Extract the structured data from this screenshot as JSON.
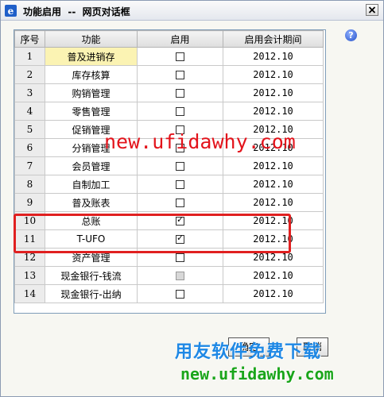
{
  "window": {
    "title": "功能启用  --  网页对话框",
    "close_glyph": "✕",
    "help_glyph": "?"
  },
  "table": {
    "headers": {
      "index": "序号",
      "function": "功能",
      "enable": "启用",
      "period": "启用会计期间"
    },
    "rows": [
      {
        "index": "1",
        "function": "普及进销存",
        "checked": false,
        "disabled": false,
        "period": "2012.10"
      },
      {
        "index": "2",
        "function": "库存核算",
        "checked": false,
        "disabled": false,
        "period": "2012.10"
      },
      {
        "index": "3",
        "function": "购销管理",
        "checked": false,
        "disabled": false,
        "period": "2012.10"
      },
      {
        "index": "4",
        "function": "零售管理",
        "checked": false,
        "disabled": false,
        "period": "2012.10"
      },
      {
        "index": "5",
        "function": "促销管理",
        "checked": false,
        "disabled": false,
        "period": "2012.10"
      },
      {
        "index": "6",
        "function": "分销管理",
        "checked": false,
        "disabled": false,
        "period": "2012.10"
      },
      {
        "index": "7",
        "function": "会员管理",
        "checked": false,
        "disabled": false,
        "period": "2012.10"
      },
      {
        "index": "8",
        "function": "自制加工",
        "checked": false,
        "disabled": false,
        "period": "2012.10"
      },
      {
        "index": "9",
        "function": "普及账表",
        "checked": false,
        "disabled": false,
        "period": "2012.10"
      },
      {
        "index": "10",
        "function": "总账",
        "checked": true,
        "disabled": false,
        "period": "2012.10"
      },
      {
        "index": "11",
        "function": "T-UFO",
        "checked": true,
        "disabled": false,
        "period": "2012.10"
      },
      {
        "index": "12",
        "function": "资产管理",
        "checked": false,
        "disabled": false,
        "period": "2012.10"
      },
      {
        "index": "13",
        "function": "现金银行-钱流",
        "checked": false,
        "disabled": true,
        "period": "2012.10"
      },
      {
        "index": "14",
        "function": "现金银行-出纳",
        "checked": false,
        "disabled": false,
        "period": "2012.10"
      }
    ]
  },
  "buttons": {
    "ok": "确定",
    "cancel": "取消"
  },
  "watermarks": {
    "overlay_url": "new.ufidawhy.com",
    "brand_text": "用友软件免费下载",
    "brand_url": "new.ufidawhy.com"
  },
  "colors": {
    "selected_row": "#fbf3b3",
    "highlight_border": "#e02020",
    "watermark_red": "#e3131b",
    "watermark_blue": "#1e88e5",
    "watermark_green": "#1aa51a"
  }
}
